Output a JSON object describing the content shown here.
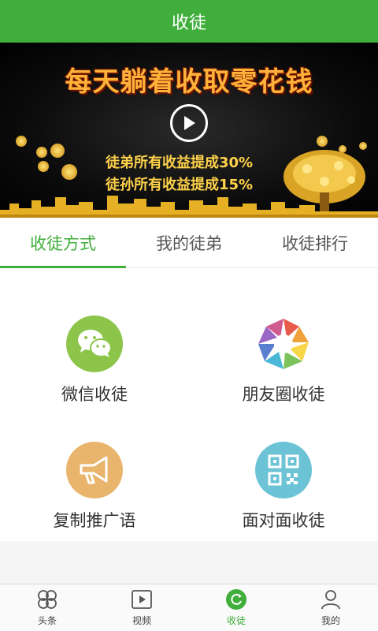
{
  "header": {
    "title": "收徒"
  },
  "banner": {
    "headline": "每天躺着收取零花钱",
    "line1": "徒弟所有收益提成30%",
    "line2": "徒孙所有收益提成15%"
  },
  "tabs": [
    {
      "label": "收徒方式",
      "active": true
    },
    {
      "label": "我的徒弟",
      "active": false
    },
    {
      "label": "收徒排行",
      "active": false
    }
  ],
  "methods": [
    {
      "label": "微信收徒",
      "icon": "wechat-icon",
      "color": "#8cc54a"
    },
    {
      "label": "朋友圈收徒",
      "icon": "moments-icon",
      "color": "#ffffff"
    },
    {
      "label": "复制推广语",
      "icon": "megaphone-icon",
      "color": "#e9b46c"
    },
    {
      "label": "面对面收徒",
      "icon": "qrcode-icon",
      "color": "#6cc3d6"
    }
  ],
  "bottom_nav": [
    {
      "label": "头条",
      "icon": "clover-icon"
    },
    {
      "label": "视频",
      "icon": "video-icon"
    },
    {
      "label": "收徒",
      "icon": "refresh-icon",
      "active": true
    },
    {
      "label": "我的",
      "icon": "person-icon"
    }
  ],
  "colors": {
    "accent": "#3fae3a"
  }
}
